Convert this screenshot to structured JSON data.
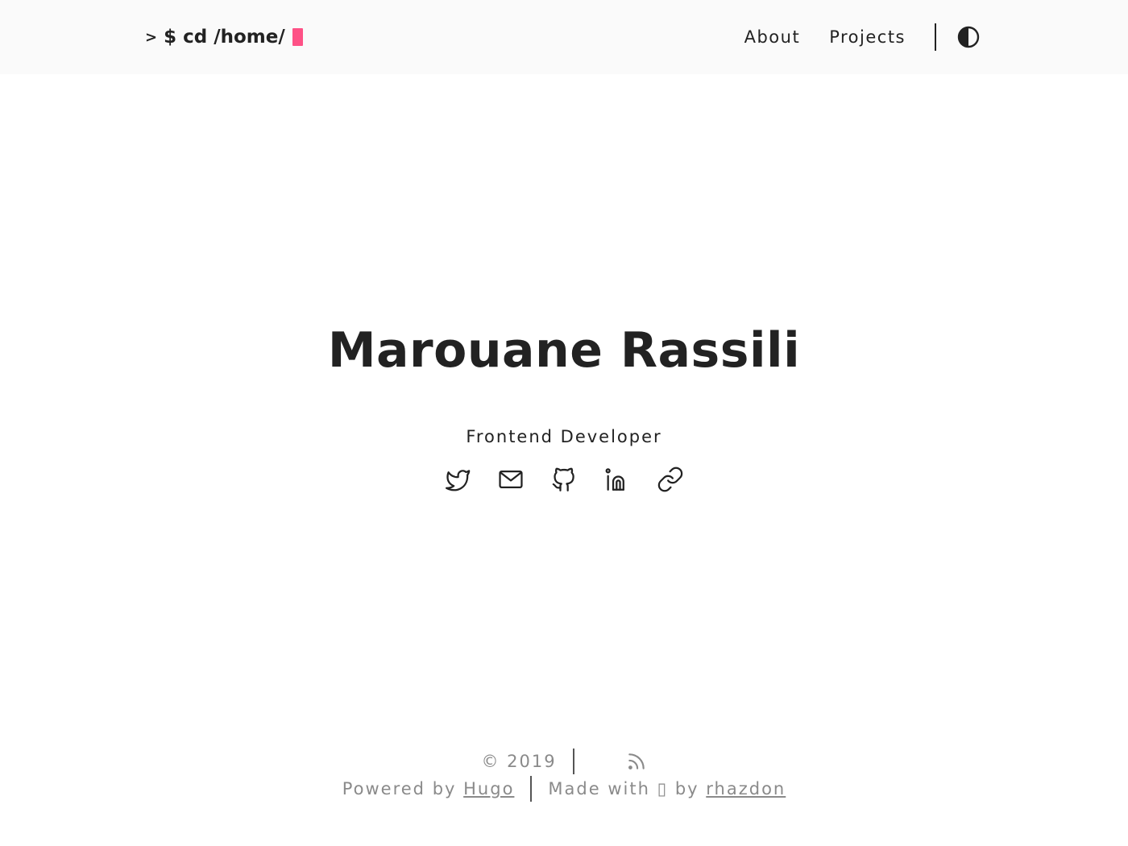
{
  "header": {
    "logo": {
      "prompt": ">",
      "command": "$ cd /home/"
    },
    "nav": [
      {
        "label": "About"
      },
      {
        "label": "Projects"
      }
    ],
    "theme_toggle_icon": "half-circle-contrast-icon"
  },
  "hero": {
    "name": "Marouane Rassili",
    "subtitle": "Frontend Developer",
    "socials": [
      {
        "icon": "twitter-icon"
      },
      {
        "icon": "mail-icon"
      },
      {
        "icon": "github-icon"
      },
      {
        "icon": "linkedin-icon"
      },
      {
        "icon": "link-icon"
      }
    ]
  },
  "footer": {
    "copyright": "© 2019",
    "rss_icon": "rss-icon",
    "powered_by_prefix": "Powered by",
    "powered_by_link": "Hugo",
    "made_with_prefix": "Made with",
    "made_with_glyph": "▯",
    "by_word": "by",
    "author_link": "rhazdon"
  },
  "colors": {
    "accent": "#fe5186",
    "text": "#222222",
    "muted": "#8a8a8a",
    "header_bg": "#fafafa"
  }
}
